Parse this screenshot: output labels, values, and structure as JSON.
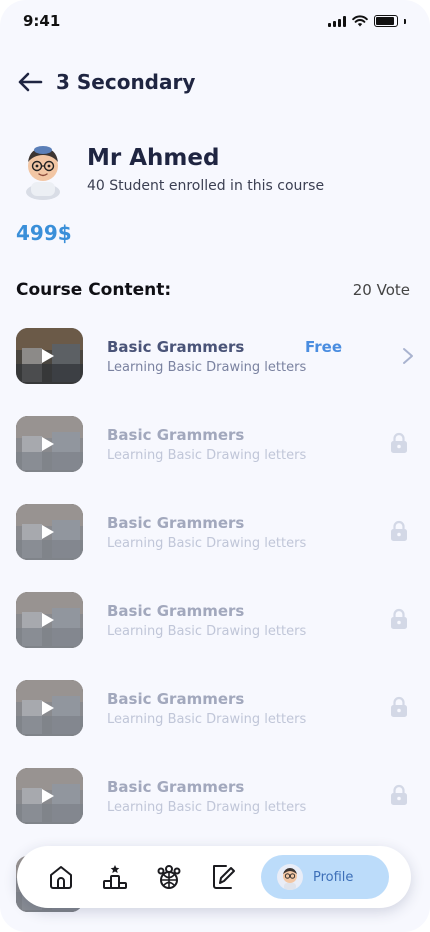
{
  "status_bar": {
    "time": "9:41"
  },
  "header": {
    "title": "3 Secondary",
    "back_icon": "arrow-left-icon"
  },
  "teacher": {
    "name": "Mr Ahmed",
    "enrolled": "40 Student enrolled in this course"
  },
  "price": "499$",
  "course_content": {
    "title": "Course Content:",
    "votes": "20 Vote"
  },
  "lessons": [
    {
      "title": "Basic Grammers",
      "subtitle": "Learning Basic Drawing letters",
      "badge": "Free",
      "locked": false
    },
    {
      "title": "Basic Grammers",
      "subtitle": "Learning Basic Drawing letters",
      "badge": "",
      "locked": true
    },
    {
      "title": "Basic Grammers",
      "subtitle": "Learning Basic Drawing letters",
      "badge": "",
      "locked": true
    },
    {
      "title": "Basic Grammers",
      "subtitle": "Learning Basic Drawing letters",
      "badge": "",
      "locked": true
    },
    {
      "title": "Basic Grammers",
      "subtitle": "Learning Basic Drawing letters",
      "badge": "",
      "locked": true
    },
    {
      "title": "Basic Grammers",
      "subtitle": "Learning Basic Drawing letters",
      "badge": "",
      "locked": true
    }
  ],
  "tabbar": {
    "icons": [
      "home-icon",
      "leaderboard-icon",
      "group-icon",
      "edit-icon"
    ],
    "profile_label": "Profile"
  },
  "colors": {
    "accent": "#3a8fd9",
    "free": "#4a8de0",
    "profile_pill": "#bcdcfa",
    "title": "#1f2541"
  }
}
